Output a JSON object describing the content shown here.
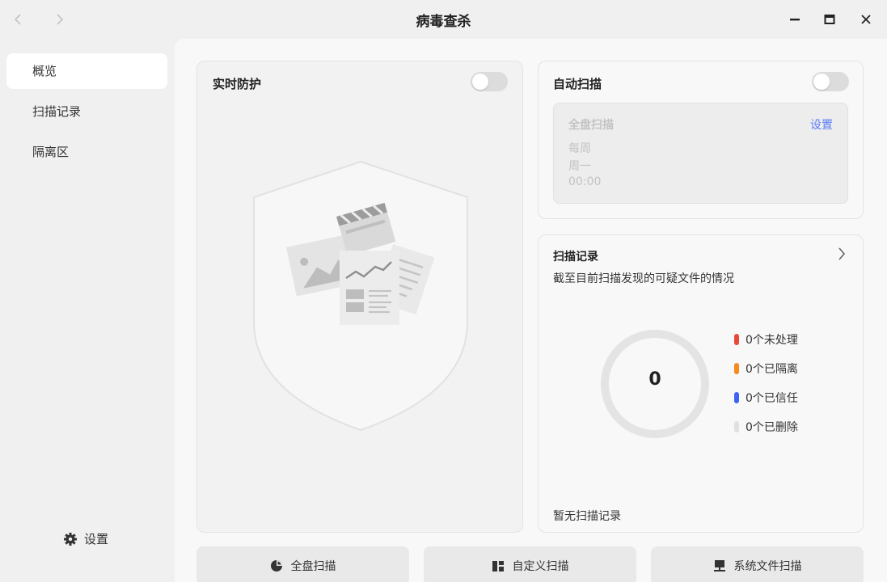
{
  "window": {
    "title": "病毒查杀",
    "back_icon": "chevron-left-icon",
    "forward_icon": "chevron-right-icon"
  },
  "sidebar": {
    "items": [
      {
        "label": "概览",
        "active": true
      },
      {
        "label": "扫描记录",
        "active": false
      },
      {
        "label": "隔离区",
        "active": false
      }
    ],
    "settings_label": "设置"
  },
  "realtime": {
    "title": "实时防护",
    "enabled": false
  },
  "auto_scan": {
    "title": "自动扫描",
    "enabled": false,
    "scan_type": "全盘扫描",
    "settings_link": "设置",
    "frequency": "每周",
    "day": "周一",
    "time": "00:00"
  },
  "scan_records": {
    "title": "扫描记录",
    "subtitle": "截至目前扫描发现的可疑文件的情况",
    "total": "0",
    "legend": [
      {
        "label": "0个未处理",
        "color": "#e54a3c"
      },
      {
        "label": "0个已隔离",
        "color": "#f58a1f"
      },
      {
        "label": "0个已信任",
        "color": "#3e64f5"
      },
      {
        "label": "0个已删除",
        "color": "#e0e0e0"
      }
    ],
    "empty_text": "暂无扫描记录"
  },
  "actions": [
    {
      "label": "全盘扫描",
      "icon": "pie-chart-icon"
    },
    {
      "label": "自定义扫描",
      "icon": "custom-layout-icon"
    },
    {
      "label": "系统文件扫描",
      "icon": "computer-icon"
    }
  ],
  "colors": {
    "accent": "#3e64f5",
    "toggle_off": "#dcdcdc",
    "card_bg": "#f2f2f2"
  }
}
